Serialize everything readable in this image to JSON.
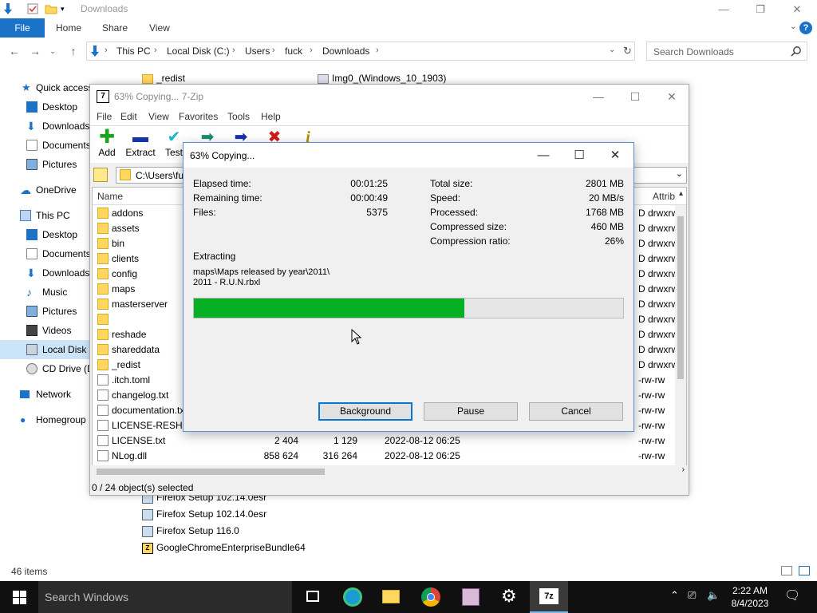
{
  "explorer": {
    "title": "Downloads",
    "ribbon": {
      "file": "File",
      "tabs": [
        "Home",
        "Share",
        "View"
      ]
    },
    "breadcrumb": [
      "This PC",
      "Local Disk (C:)",
      "Users",
      "fuck",
      "Downloads"
    ],
    "search_placeholder": "Search Downloads",
    "nav": [
      {
        "label": "Quick access",
        "icon": "star-icon"
      },
      {
        "label": "Desktop",
        "icon": "desktop-icon"
      },
      {
        "label": "Downloads",
        "icon": "download-icon"
      },
      {
        "label": "Documents",
        "icon": "documents-icon"
      },
      {
        "label": "Pictures",
        "icon": "pictures-icon"
      },
      {
        "label": "OneDrive",
        "icon": "cloud-icon"
      },
      {
        "label": "This PC",
        "icon": "computer-icon"
      },
      {
        "label": "Desktop",
        "icon": "desktop-icon"
      },
      {
        "label": "Documents",
        "icon": "documents-icon"
      },
      {
        "label": "Downloads",
        "icon": "download-icon"
      },
      {
        "label": "Music",
        "icon": "music-icon"
      },
      {
        "label": "Pictures",
        "icon": "pictures-icon"
      },
      {
        "label": "Videos",
        "icon": "videos-icon"
      },
      {
        "label": "Local Disk (",
        "icon": "drive-icon"
      },
      {
        "label": "CD Drive (D",
        "icon": "cd-drive-icon"
      },
      {
        "label": "Network",
        "icon": "network-icon"
      },
      {
        "label": "Homegroup",
        "icon": "homegroup-icon"
      }
    ],
    "top_files": [
      "_redist",
      "Img0_(Windows_10_1903)"
    ],
    "bottom_files": [
      "Firefox Setup 102.14.0esr",
      "Firefox Setup 102.14.0esr",
      "Firefox Setup 116.0",
      "GoogleChromeEnterpriseBundle64"
    ],
    "status": "46 items"
  },
  "sevenzip": {
    "title": "63% Copying... 7-Zip",
    "menu": [
      "File",
      "Edit",
      "View",
      "Favorites",
      "Tools",
      "Help"
    ],
    "tools": [
      {
        "label": "Add",
        "icon": "add-icon",
        "color": "#1fa31f"
      },
      {
        "label": "Extract",
        "icon": "extract-icon",
        "color": "#1434a4"
      },
      {
        "label": "Test",
        "icon": "test-icon",
        "color": "#19b5c9"
      },
      {
        "label": "",
        "icon": "copy-icon",
        "color": "#1d8c6e"
      },
      {
        "label": "",
        "icon": "move-icon",
        "color": "#1434a4"
      },
      {
        "label": "",
        "icon": "delete-icon",
        "color": "#d11a1a"
      },
      {
        "label": "",
        "icon": "info-icon",
        "color": "#b08a00"
      }
    ],
    "path": "C:\\Users\\fu",
    "headers": {
      "name": "Name",
      "attrib": "Attrib"
    },
    "rows": [
      {
        "name": "addons",
        "type": "folder",
        "size": "",
        "packed": "",
        "modified": "",
        "attrib": "D drwxrw"
      },
      {
        "name": "assets",
        "type": "folder",
        "size": "",
        "packed": "",
        "modified": "",
        "attrib": "D drwxrw"
      },
      {
        "name": "bin",
        "type": "folder",
        "size": "",
        "packed": "",
        "modified": "",
        "attrib": "D drwxrw"
      },
      {
        "name": "clients",
        "type": "folder",
        "size": "",
        "packed": "",
        "modified": "",
        "attrib": "D drwxrw"
      },
      {
        "name": "config",
        "type": "folder",
        "size": "",
        "packed": "",
        "modified": "",
        "attrib": "D drwxrw"
      },
      {
        "name": "maps",
        "type": "folder",
        "size": "",
        "packed": "",
        "modified": "",
        "attrib": "D drwxrw"
      },
      {
        "name": "masterserver",
        "type": "folder",
        "size": "",
        "packed": "",
        "modified": "",
        "attrib": "D drwxrw"
      },
      {
        "name": "",
        "type": "folder",
        "size": "",
        "packed": "",
        "modified": "",
        "attrib": "D drwxrw"
      },
      {
        "name": "reshade",
        "type": "folder",
        "size": "",
        "packed": "",
        "modified": "",
        "attrib": "D drwxrw"
      },
      {
        "name": "shareddata",
        "type": "folder",
        "size": "",
        "packed": "",
        "modified": "",
        "attrib": "D drwxrw"
      },
      {
        "name": "_redist",
        "type": "folder",
        "size": "",
        "packed": "",
        "modified": "",
        "attrib": "D drwxrw"
      },
      {
        "name": ".itch.toml",
        "type": "file",
        "size": "",
        "packed": "",
        "modified": "",
        "attrib": "-rw-rw"
      },
      {
        "name": "changelog.txt",
        "type": "file",
        "size": "",
        "packed": "",
        "modified": "",
        "attrib": "-rw-rw"
      },
      {
        "name": "documentation.txt",
        "type": "file",
        "size": "",
        "packed": "",
        "modified": "",
        "attrib": "-rw-rw"
      },
      {
        "name": "LICENSE-RESHAD",
        "type": "file",
        "size": "",
        "packed": "",
        "modified": "",
        "attrib": "-rw-rw"
      },
      {
        "name": "LICENSE.txt",
        "type": "file",
        "size": "2 404",
        "packed": "1 129",
        "modified": "2022-08-12 06:25",
        "attrib": "-rw-rw"
      },
      {
        "name": "NLog.dll",
        "type": "file",
        "size": "858 624",
        "packed": "316 264",
        "modified": "2022-08-12 06:25",
        "attrib": "-rw-rw"
      }
    ],
    "status": "0 / 24 object(s) selected"
  },
  "progress": {
    "title": "63% Copying...",
    "left_stats": [
      {
        "label": "Elapsed time:",
        "value": "00:01:25"
      },
      {
        "label": "Remaining time:",
        "value": "00:00:49"
      },
      {
        "label": "Files:",
        "value": "5375"
      }
    ],
    "right_stats": [
      {
        "label": "Total size:",
        "value": "2801 MB"
      },
      {
        "label": "Speed:",
        "value": "20 MB/s"
      },
      {
        "label": "Processed:",
        "value": "1768 MB"
      },
      {
        "label": "Compressed size:",
        "value": "460 MB"
      },
      {
        "label": "Compression ratio:",
        "value": "26%"
      }
    ],
    "operation": "Extracting",
    "current_file_line1": "maps\\Maps released by year\\2011\\",
    "current_file_line2": "2011 - R.U.N.rbxl",
    "percent": 63,
    "buttons": {
      "background": "Background",
      "pause": "Pause",
      "cancel": "Cancel"
    }
  },
  "taskbar": {
    "search_placeholder": "Search Windows",
    "apps": [
      "task-view-icon",
      "edge-icon",
      "file-explorer-icon",
      "chrome-icon",
      "winrar-icon",
      "settings-icon",
      "7zip-icon"
    ],
    "time": "2:22 AM",
    "date": "8/4/2023"
  },
  "colors": {
    "accent": "#1a73c9",
    "progress_fill": "#06b025",
    "taskbar": "#101010"
  }
}
